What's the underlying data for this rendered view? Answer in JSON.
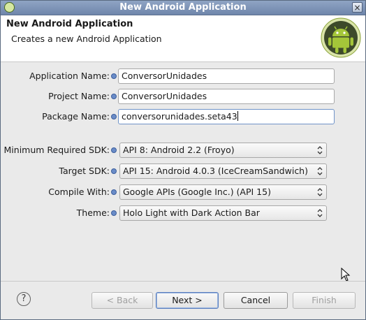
{
  "window": {
    "title": "New Android Application"
  },
  "banner": {
    "heading": "New Android Application",
    "description": "Creates a new Android Application"
  },
  "form": {
    "application_name": {
      "label": "Application Name:",
      "value": "ConversorUnidades"
    },
    "project_name": {
      "label": "Project Name:",
      "value": "ConversorUnidades"
    },
    "package_name": {
      "label": "Package Name:",
      "value": "conversorunidades.seta43"
    },
    "min_sdk": {
      "label": "Minimum Required SDK:",
      "value": "API 8: Android 2.2 (Froyo)"
    },
    "target_sdk": {
      "label": "Target SDK:",
      "value": "API 15: Android 4.0.3 (IceCreamSandwich)"
    },
    "compile_with": {
      "label": "Compile With:",
      "value": "Google APIs (Google Inc.) (API 15)"
    },
    "theme": {
      "label": "Theme:",
      "value": "Holo Light with Dark Action Bar"
    }
  },
  "buttons": {
    "help": "?",
    "back": "< Back",
    "next": "Next >",
    "cancel": "Cancel",
    "finish": "Finish"
  },
  "icons": {
    "app": "eclipse-icon",
    "close": "close-icon",
    "logo": "android-logo-icon",
    "info": "info-icon",
    "combo_arrows": "updown-arrows-icon",
    "cursor": "mouse-pointer-icon"
  },
  "colors": {
    "titlebar": "#7d93b8",
    "android_green": "#a4c639",
    "info_blue": "#6a8cc8",
    "disabled_text": "#a0a0a0"
  }
}
